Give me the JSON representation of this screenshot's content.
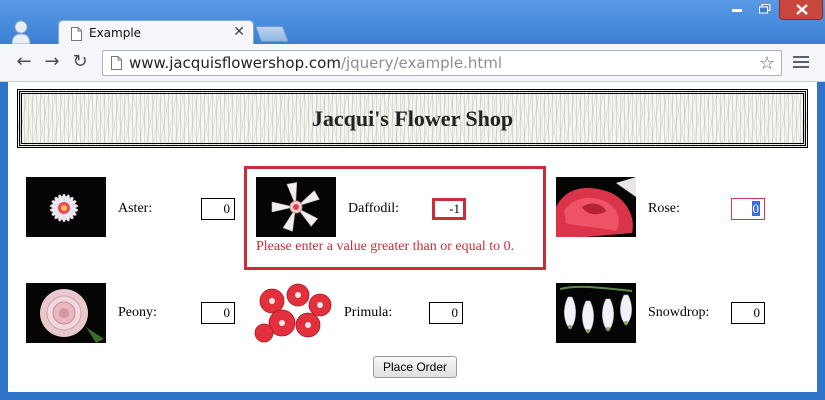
{
  "browser": {
    "tab_title": "Example",
    "tab_close": "✕",
    "url_domain": "www.jacquisflowershop.com",
    "url_path": "/jquery/example.html"
  },
  "page": {
    "title": "Jacqui's Flower Shop",
    "error_message": "Please enter a value greater than or equal to 0.",
    "place_order_label": "Place Order",
    "flowers": [
      {
        "name": "Aster:",
        "quantity": "0"
      },
      {
        "name": "Daffodil:",
        "quantity": "-1"
      },
      {
        "name": "Rose:",
        "quantity": "0"
      },
      {
        "name": "Peony:",
        "quantity": "0"
      },
      {
        "name": "Primula:",
        "quantity": "0"
      },
      {
        "name": "Snowdrop:",
        "quantity": "0"
      }
    ]
  },
  "colors": {
    "error": "#cc2b3a",
    "chrome_blue": "#3a7fd4"
  }
}
